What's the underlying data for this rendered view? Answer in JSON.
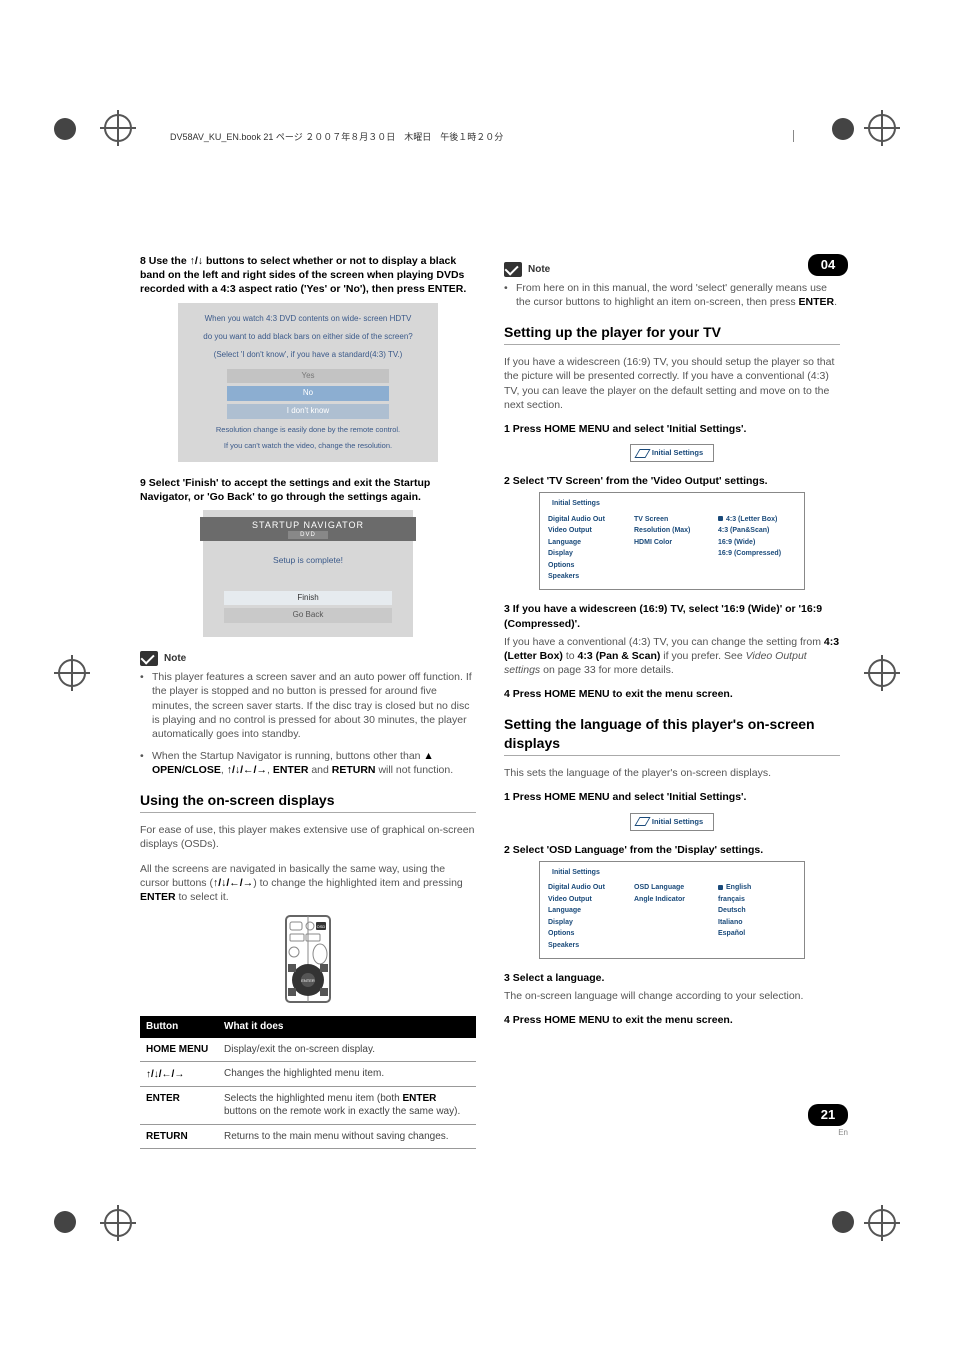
{
  "chapter_number": "04",
  "page_number": "21",
  "page_lang": "En",
  "header_strip": "DV58AV_KU_EN.book  21 ページ  ２００７年８月３０日　木曜日　午後１時２０分",
  "left": {
    "step8": "8    Use the ↑/↓ buttons to select whether or not to display a black band on the left and right sides of the screen when playing DVDs recorded with a 4:3 aspect ratio ('Yes' or 'No'), then press ENTER.",
    "box1": {
      "q1": "When you watch 4:3 DVD contents on wide- screen HDTV",
      "q2": "do you want to add black bars on either side of the screen?",
      "q3": "(Select 'I don't know', if you have a standard(4:3) TV.)",
      "opt_yes": "Yes",
      "opt_no": "No",
      "opt_dk": "I don't know",
      "foot1": "Resolution change is easily done by the remote control.",
      "foot2": "If you can't watch the video, change the resolution."
    },
    "step9": "9    Select 'Finish' to accept the settings and exit the Startup Navigator, or 'Go Back' to go through the settings again.",
    "box2": {
      "title": "STARTUP NAVIGATOR",
      "sub": "DVD",
      "complete": "Setup is complete!",
      "finish": "Finish",
      "goback": "Go Back"
    },
    "note_label": "Note",
    "note1": "This player features a screen saver and an auto power off function. If the player is stopped and no button is pressed for around five minutes, the screen saver starts. If the disc tray is closed but no disc is playing and no control is pressed for about 30 minutes, the player automatically goes into standby.",
    "note2_pre": "When the Startup Navigator is running, buttons other than ",
    "note2_b1": "▲ OPEN/CLOSE",
    "note2_mid1": ", ",
    "note2_b2": "↑/↓/←/→",
    "note2_mid2": ", ",
    "note2_b3": "ENTER",
    "note2_mid3": " and ",
    "note2_b4": "RETURN",
    "note2_post": " will not function.",
    "section_osd": "Using the on-screen displays",
    "osd_p1": "For ease of use, this player makes extensive use of graphical on-screen displays (OSDs).",
    "osd_p2_pre": "All the screens are navigated in basically the same way, using the cursor buttons (",
    "osd_p2_arrows": "↑/↓/←/→",
    "osd_p2_mid": ") to change the highlighted item and pressing ",
    "osd_p2_enter": "ENTER",
    "osd_p2_post": " to select it.",
    "table": {
      "h1": "Button",
      "h2": "What it does",
      "r1k": "HOME MENU",
      "r1v": "Display/exit the on-screen display.",
      "r2k": "↑/↓/←/→",
      "r2v": "Changes the highlighted menu item.",
      "r3k": "ENTER",
      "r3v_a": "Selects the highlighted menu item (both ",
      "r3v_b": "ENTER",
      "r3v_c": " buttons on the remote work in exactly the same way).",
      "r4k": "RETURN",
      "r4v": "Returns to the main menu without saving changes."
    }
  },
  "right": {
    "note_label": "Note",
    "note_text_pre": "From here on in this manual, the word 'select' generally means use the cursor buttons to highlight an item on-screen, then press ",
    "note_text_b": "ENTER",
    "note_text_post": ".",
    "section_tv": "Setting up the player for your TV",
    "tv_p1": "If you have a widescreen (16:9) TV, you should setup the player so that the picture will be presented correctly. If you have a conventional (4:3) TV, you can leave the player on the default setting and move on to the next section.",
    "tv_s1": "1    Press HOME MENU and select 'Initial Settings'.",
    "mini_initial": "Initial Settings",
    "tv_s2": "2    Select 'TV Screen' from the 'Video Output' settings.",
    "settings1": {
      "head": "Initial Settings",
      "left": [
        "Digital Audio Out",
        "Video Output",
        "Language",
        "Display",
        "Options",
        "Speakers"
      ],
      "mid": [
        "TV Screen",
        "Resolution (Max)",
        "HDMI Color"
      ],
      "right": [
        "4:3 (Letter Box)",
        "4:3 (Pan&Scan)",
        "16:9 (Wide)",
        "16:9 (Compressed)"
      ]
    },
    "tv_s3_a": "3    If you have a widescreen (16:9) TV, select '16:9 (Wide)' or '16:9 (Compressed)'.",
    "tv_s3_b_pre": "If you have a conventional (4:3) TV, you can change the setting from ",
    "tv_s3_b_b1": "4:3 (Letter Box)",
    "tv_s3_b_mid": " to ",
    "tv_s3_b_b2": "4:3 (Pan & Scan)",
    "tv_s3_b_post1": " if you prefer. See ",
    "tv_s3_b_i": "Video Output settings",
    "tv_s3_b_post2": " on page 33 for more details.",
    "tv_s4": "4    Press HOME MENU to exit the menu screen.",
    "section_lang": "Setting the language of this player's on-screen displays",
    "lang_p1": "This sets the language of the player's on-screen displays.",
    "lang_s1": "1    Press HOME MENU and select 'Initial Settings'.",
    "lang_s2": "2    Select 'OSD Language' from the 'Display' settings.",
    "settings2": {
      "head": "Initial Settings",
      "left": [
        "Digital Audio Out",
        "Video Output",
        "Language",
        "Display",
        "Options",
        "Speakers"
      ],
      "mid": [
        "OSD Language",
        "Angle Indicator"
      ],
      "right": [
        "English",
        "français",
        "Deutsch",
        "Italiano",
        "Español"
      ]
    },
    "lang_s3": "3    Select a language.",
    "lang_s3_sub": "The on-screen language will change according to your selection.",
    "lang_s4": "4    Press HOME MENU to exit the menu screen."
  }
}
